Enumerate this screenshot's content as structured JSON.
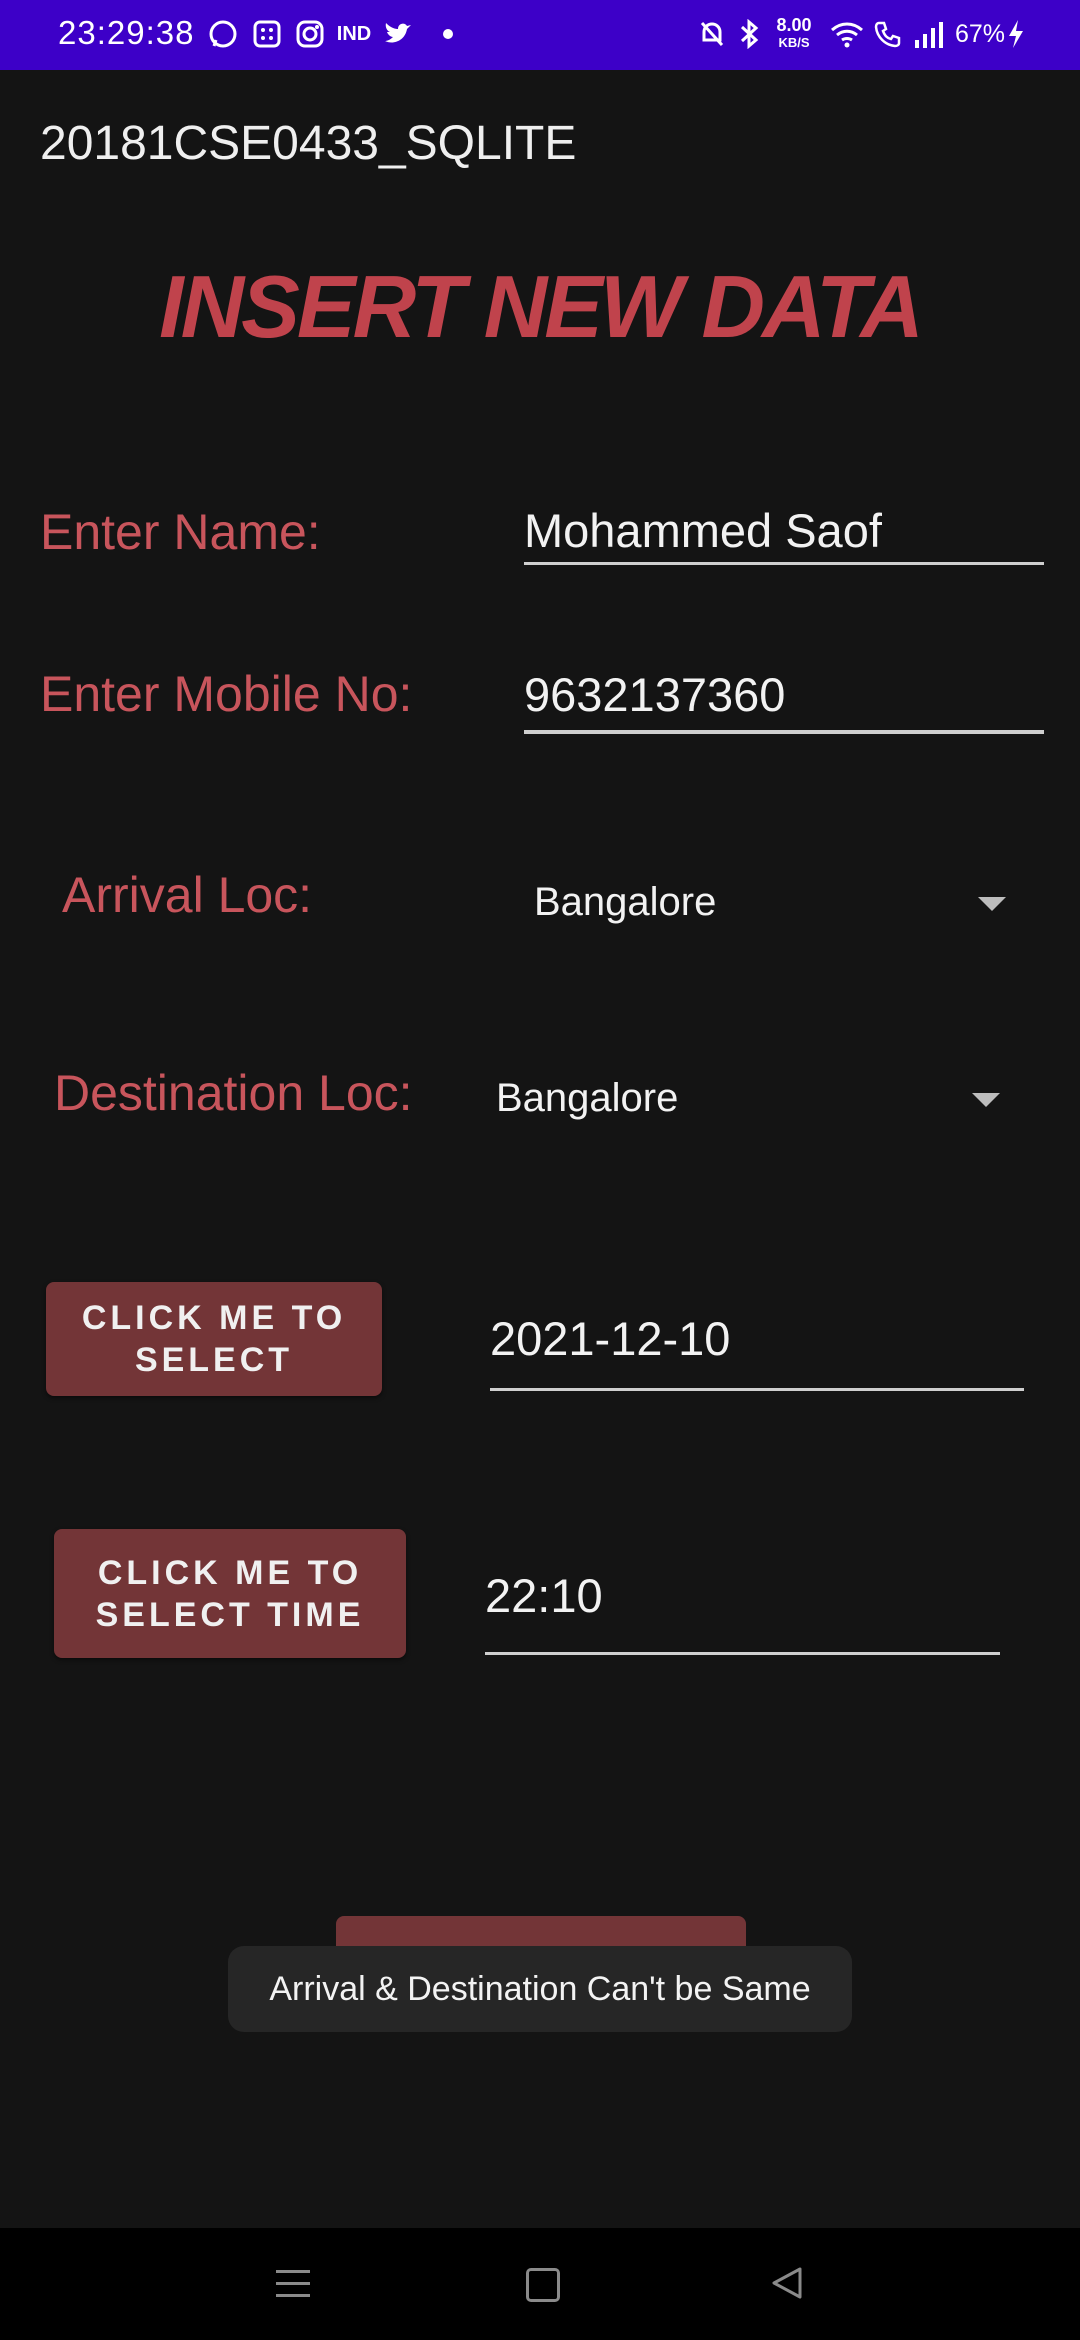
{
  "status_bar": {
    "time": "23:29:38",
    "net_speed_value": "8.00",
    "net_speed_unit": "KB/S",
    "battery": "67%",
    "icons": [
      "whatsapp-icon",
      "calculator-icon",
      "instagram-icon",
      "ind-icon",
      "twitter-icon",
      "dot-icon",
      "mute-icon",
      "bluetooth-icon",
      "wifi-icon",
      "wifi-call-icon",
      "signal-icon",
      "charging-icon"
    ]
  },
  "app_bar": {
    "title": "20181CSE0433_SQLITE"
  },
  "heading": "INSERT NEW DATA",
  "form": {
    "name_label": "Enter Name:",
    "name_value": "Mohammed Saof",
    "mobile_label": "Enter Mobile No:",
    "mobile_value": "9632137360",
    "arrival_label": "Arrival Loc:",
    "arrival_value": "Bangalore",
    "destination_label": "Destination Loc:",
    "destination_value": "Bangalore",
    "date_button": "CLICK ME TO SELECT",
    "date_value": "2021-12-10",
    "time_button": "CLICK ME TO SELECT TIME",
    "time_value": "22:10"
  },
  "toast": "Arrival & Destination Can't be Same",
  "colors": {
    "status_bar": "#3d00c8",
    "accent": "#c0434c",
    "button": "#733537",
    "background": "#141414"
  }
}
